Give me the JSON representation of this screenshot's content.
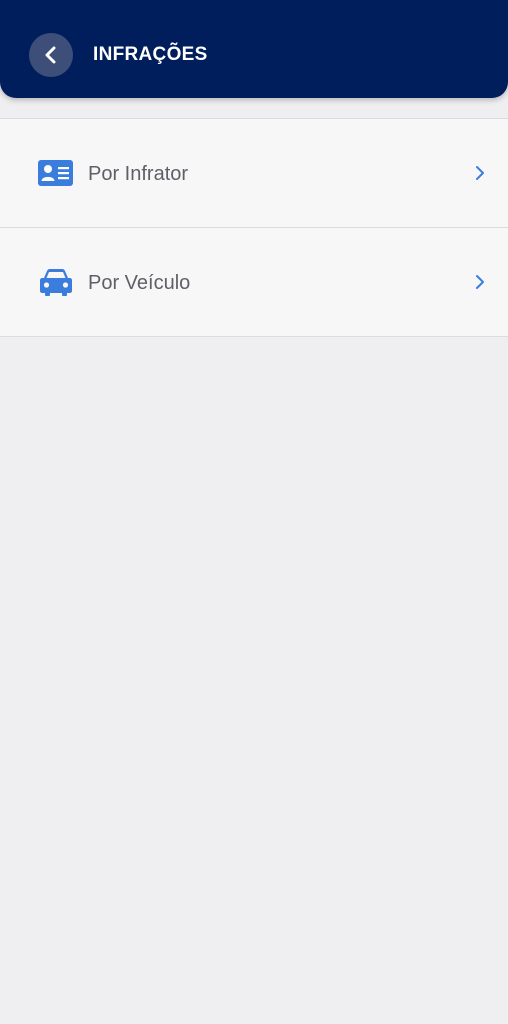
{
  "header": {
    "title": "INFRAÇÕES",
    "back_icon": "chevron-left-icon",
    "background_color": "#001e5b"
  },
  "menu": {
    "items": [
      {
        "label": "Por Infrator",
        "icon": "id-card-icon",
        "trailing_icon": "chevron-right-icon"
      },
      {
        "label": "Por Veículo",
        "icon": "car-icon",
        "trailing_icon": "chevron-right-icon"
      }
    ],
    "accent_color": "#3b7ddd"
  }
}
